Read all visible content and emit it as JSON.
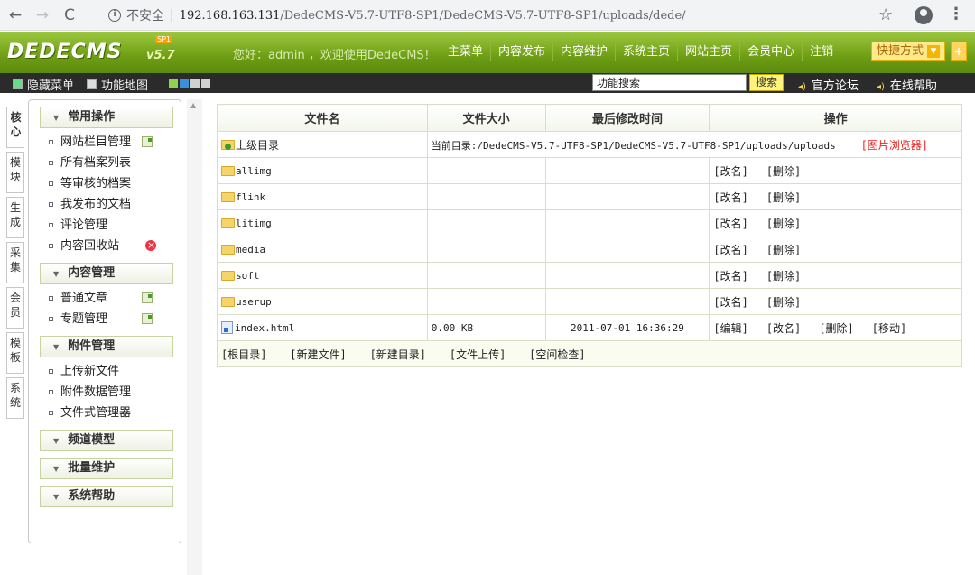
{
  "browser": {
    "back": "←",
    "forward": "→",
    "reload": "C",
    "insecure_label": "不安全",
    "url_host": "192.168.163.131",
    "url_path": "/DedeCMS-V5.7-UTF8-SP1/DedeCMS-V5.7-UTF8-SP1/uploads/dede/",
    "star": "☆",
    "menu": "⋮"
  },
  "header": {
    "logo": "DEDECMS",
    "version": "v5.7",
    "sp": "SP1",
    "greeting": "您好：admin ，欢迎使用DedeCMS！",
    "nav": [
      "主菜单",
      "内容发布",
      "内容维护",
      "系统主页",
      "网站主页",
      "会员中心",
      "注销"
    ],
    "quick_label": "快捷方式",
    "quick_arrow": "▼",
    "quick_add": "+"
  },
  "toolbar": {
    "hide_menu": "隐藏菜单",
    "site_map": "功能地图",
    "skin_colors": [
      "#8fd14f",
      "#3b8fd8",
      "#d0d0d0",
      "#d0d0d0"
    ],
    "search_value": "功能搜索",
    "search_button": "搜索",
    "forum": "官方论坛",
    "help": "在线帮助",
    "sound_icon": "◂)"
  },
  "vtabs": [
    {
      "l1": "核",
      "l2": "心"
    },
    {
      "l1": "模",
      "l2": "块"
    },
    {
      "l1": "生",
      "l2": "成"
    },
    {
      "l1": "采",
      "l2": "集"
    },
    {
      "l1": "会",
      "l2": "员"
    },
    {
      "l1": "模",
      "l2": "板"
    },
    {
      "l1": "系",
      "l2": "统"
    }
  ],
  "sidebar": {
    "sections": [
      {
        "title": "常用操作",
        "items": [
          "网站栏目管理",
          "所有档案列表",
          "等审核的档案",
          "我发布的文档",
          "评论管理",
          "内容回收站"
        ]
      },
      {
        "title": "内容管理",
        "items": [
          "普通文章",
          "专题管理"
        ]
      },
      {
        "title": "附件管理",
        "items": [
          "上传新文件",
          "附件数据管理",
          "文件式管理器"
        ]
      },
      {
        "title": "频道模型",
        "items": []
      },
      {
        "title": "批量维护",
        "items": []
      },
      {
        "title": "系统帮助",
        "items": []
      }
    ]
  },
  "table": {
    "headers": [
      "文件名",
      "文件大小",
      "最后修改时间",
      "操作"
    ],
    "parent": {
      "name": "上级目录",
      "current_dir": "当前目录:/DedeCMS-V5.7-UTF8-SP1/DedeCMS-V5.7-UTF8-SP1/uploads/uploads",
      "image_browser": "[图片浏览器]"
    },
    "folders": [
      "allimg",
      "flink",
      "litimg",
      "media",
      "soft",
      "userup"
    ],
    "file": {
      "name": "index.html",
      "size": "0.00 KB",
      "modified": "2011-07-01 16:36:29"
    },
    "actions": {
      "rename": "[改名]",
      "delete": "[删除]",
      "edit": "[编辑]",
      "move": "[移动]"
    },
    "footer": [
      "[根目录]",
      "[新建文件]",
      "[新建目录]",
      "[文件上传]",
      "[空间检查]"
    ]
  }
}
